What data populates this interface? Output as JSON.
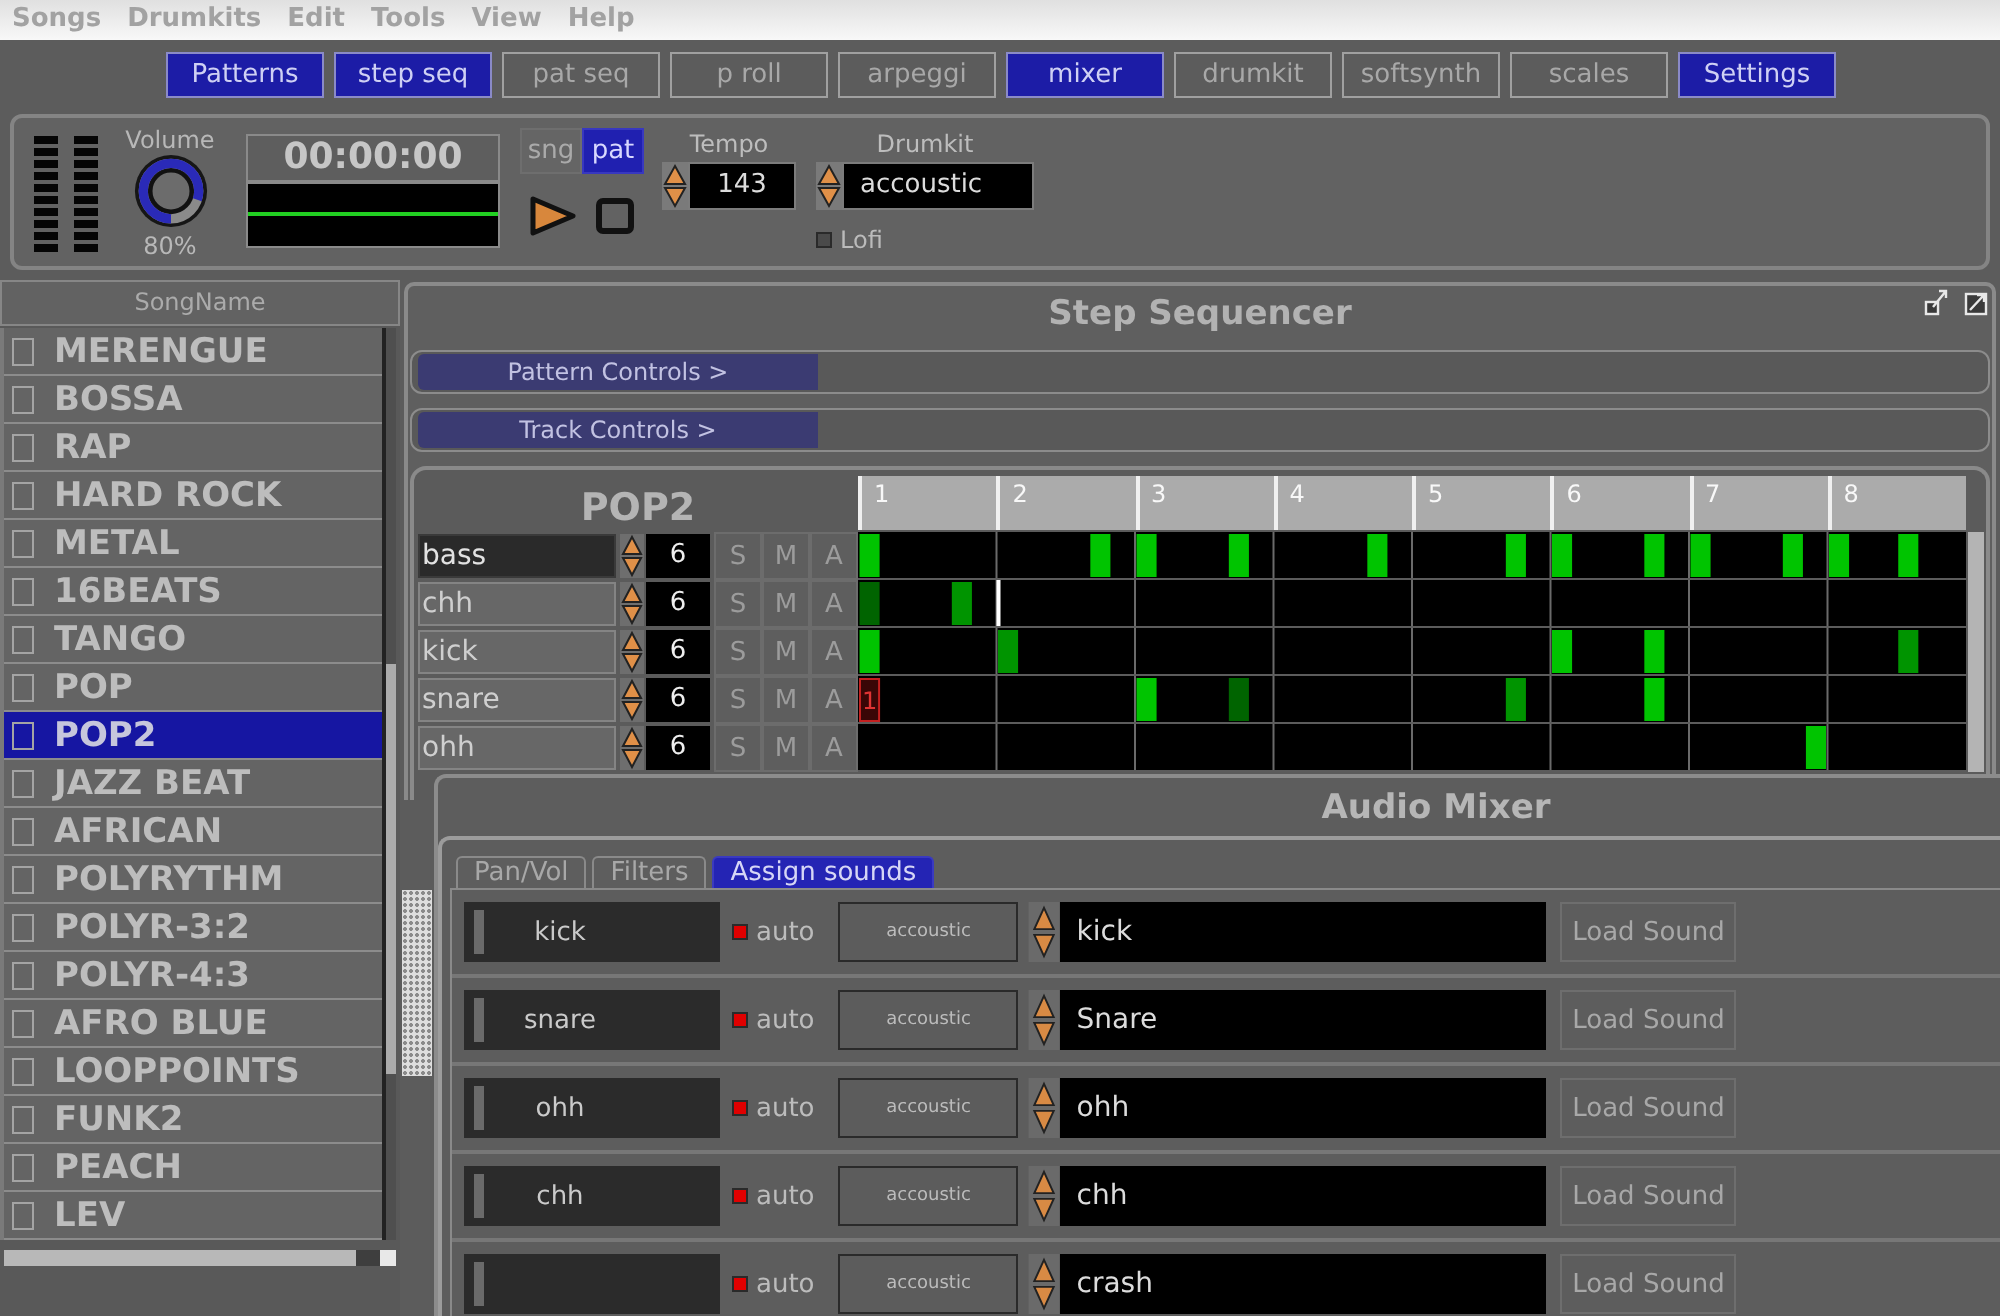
{
  "menu_bar": [
    "Songs",
    "Drumkits",
    "Edit",
    "Tools",
    "View",
    "Help"
  ],
  "view_tabs": [
    {
      "label": "Patterns",
      "selected": true
    },
    {
      "label": "step seq",
      "selected": true
    },
    {
      "label": "pat seq",
      "selected": false
    },
    {
      "label": "p roll",
      "selected": false
    },
    {
      "label": "arpeggi",
      "selected": false
    },
    {
      "label": "mixer",
      "selected": true
    },
    {
      "label": "drumkit",
      "selected": false
    },
    {
      "label": "softsynth",
      "selected": false
    },
    {
      "label": "scales",
      "selected": false
    },
    {
      "label": "Settings",
      "selected": true
    }
  ],
  "transport": {
    "volume": {
      "label": "Volume",
      "level": 0.8,
      "reading": "80%"
    },
    "time": "00:00:00",
    "mode_toggle": [
      {
        "label": "sng",
        "selected": false
      },
      {
        "label": "pat",
        "selected": true
      }
    ],
    "tempo": {
      "label": "Tempo",
      "value": "143"
    },
    "drumkit": {
      "label": "Drumkit",
      "value": "accoustic"
    },
    "lofi": {
      "label": "Lofi",
      "checked": false
    }
  },
  "song_list": {
    "header": "SongName",
    "items": [
      {
        "name": "MERENGUE",
        "checked": false,
        "selected": false
      },
      {
        "name": "BOSSA",
        "checked": false,
        "selected": false
      },
      {
        "name": "RAP",
        "checked": false,
        "selected": false
      },
      {
        "name": "HARD ROCK",
        "checked": false,
        "selected": false
      },
      {
        "name": "METAL",
        "checked": false,
        "selected": false
      },
      {
        "name": "16BEATS",
        "checked": false,
        "selected": false
      },
      {
        "name": "TANGO",
        "checked": false,
        "selected": false
      },
      {
        "name": "POP",
        "checked": false,
        "selected": false
      },
      {
        "name": "POP2",
        "checked": false,
        "selected": true
      },
      {
        "name": "JAZZ BEAT",
        "checked": false,
        "selected": false
      },
      {
        "name": "AFRICAN",
        "checked": false,
        "selected": false
      },
      {
        "name": "POLYRYTHM",
        "checked": false,
        "selected": false
      },
      {
        "name": "POLYR-3:2",
        "checked": false,
        "selected": false
      },
      {
        "name": "POLYR-4:3",
        "checked": false,
        "selected": false
      },
      {
        "name": "AFRO BLUE",
        "checked": false,
        "selected": false
      },
      {
        "name": "LOOPPOINTS",
        "checked": false,
        "selected": false
      },
      {
        "name": "FUNK2",
        "checked": false,
        "selected": false
      },
      {
        "name": "PEACH",
        "checked": false,
        "selected": false
      },
      {
        "name": "LEV",
        "checked": false,
        "selected": false
      }
    ]
  },
  "step_sequencer": {
    "title": "Step Sequencer",
    "sections": [
      "Pattern Controls >",
      "Track Controls >"
    ],
    "pattern_name": "POP2",
    "beats": [
      "1",
      "2",
      "3",
      "4",
      "5",
      "6",
      "7",
      "8"
    ],
    "tracks": [
      {
        "name": "bass",
        "selected": true,
        "value": "6",
        "buttons": [
          "S",
          "M",
          "A"
        ],
        "steps": [
          {
            "kind": "on"
          },
          {
            "kind": "off"
          },
          {
            "kind": "off"
          },
          {
            "kind": "off"
          },
          {
            "kind": "off"
          },
          {
            "kind": "off"
          },
          {
            "kind": "off"
          },
          {
            "kind": "off"
          },
          {
            "kind": "off"
          },
          {
            "kind": "off"
          },
          {
            "kind": "on"
          },
          {
            "kind": "off"
          },
          {
            "kind": "on"
          },
          {
            "kind": "off"
          },
          {
            "kind": "off"
          },
          {
            "kind": "off"
          },
          {
            "kind": "on"
          },
          {
            "kind": "off"
          },
          {
            "kind": "off"
          },
          {
            "kind": "off"
          },
          {
            "kind": "off"
          },
          {
            "kind": "off"
          },
          {
            "kind": "on"
          },
          {
            "kind": "off"
          },
          {
            "kind": "off"
          },
          {
            "kind": "off"
          },
          {
            "kind": "off"
          },
          {
            "kind": "off"
          },
          {
            "kind": "on"
          },
          {
            "kind": "off"
          },
          {
            "kind": "on"
          },
          {
            "kind": "off"
          },
          {
            "kind": "off"
          },
          {
            "kind": "off"
          },
          {
            "kind": "on"
          },
          {
            "kind": "off"
          },
          {
            "kind": "on"
          },
          {
            "kind": "off"
          },
          {
            "kind": "off"
          },
          {
            "kind": "off"
          },
          {
            "kind": "on"
          },
          {
            "kind": "off"
          },
          {
            "kind": "on"
          },
          {
            "kind": "off"
          },
          {
            "kind": "off"
          },
          {
            "kind": "on"
          },
          {
            "kind": "off"
          },
          {
            "kind": "off"
          }
        ]
      },
      {
        "name": "chh",
        "selected": false,
        "value": "6",
        "buttons": [
          "S",
          "M",
          "A"
        ],
        "steps": [
          {
            "kind": "dim"
          },
          {
            "kind": "off"
          },
          {
            "kind": "off"
          },
          {
            "kind": "off"
          },
          {
            "kind": "mid"
          },
          {
            "kind": "off"
          },
          {
            "kind": "mark"
          },
          {
            "kind": "off"
          },
          {
            "kind": "off"
          },
          {
            "kind": "off"
          },
          {
            "kind": "off"
          },
          {
            "kind": "off"
          },
          {
            "kind": "off"
          },
          {
            "kind": "off"
          },
          {
            "kind": "off"
          },
          {
            "kind": "off"
          },
          {
            "kind": "off"
          },
          {
            "kind": "off"
          },
          {
            "kind": "off"
          },
          {
            "kind": "off"
          },
          {
            "kind": "off"
          },
          {
            "kind": "off"
          },
          {
            "kind": "off"
          },
          {
            "kind": "off"
          },
          {
            "kind": "off"
          },
          {
            "kind": "off"
          },
          {
            "kind": "off"
          },
          {
            "kind": "off"
          },
          {
            "kind": "off"
          },
          {
            "kind": "off"
          },
          {
            "kind": "off"
          },
          {
            "kind": "off"
          },
          {
            "kind": "off"
          },
          {
            "kind": "off"
          },
          {
            "kind": "off"
          },
          {
            "kind": "off"
          },
          {
            "kind": "off"
          },
          {
            "kind": "off"
          },
          {
            "kind": "off"
          },
          {
            "kind": "off"
          },
          {
            "kind": "off"
          },
          {
            "kind": "off"
          },
          {
            "kind": "off"
          },
          {
            "kind": "off"
          },
          {
            "kind": "off"
          },
          {
            "kind": "off"
          },
          {
            "kind": "off"
          },
          {
            "kind": "off"
          }
        ]
      },
      {
        "name": "kick",
        "selected": false,
        "value": "6",
        "buttons": [
          "S",
          "M",
          "A"
        ],
        "steps": [
          {
            "kind": "on"
          },
          {
            "kind": "off"
          },
          {
            "kind": "off"
          },
          {
            "kind": "off"
          },
          {
            "kind": "off"
          },
          {
            "kind": "off"
          },
          {
            "kind": "mid"
          },
          {
            "kind": "off"
          },
          {
            "kind": "off"
          },
          {
            "kind": "off"
          },
          {
            "kind": "off"
          },
          {
            "kind": "off"
          },
          {
            "kind": "off"
          },
          {
            "kind": "off"
          },
          {
            "kind": "off"
          },
          {
            "kind": "off"
          },
          {
            "kind": "off"
          },
          {
            "kind": "off"
          },
          {
            "kind": "off"
          },
          {
            "kind": "off"
          },
          {
            "kind": "off"
          },
          {
            "kind": "off"
          },
          {
            "kind": "off"
          },
          {
            "kind": "off"
          },
          {
            "kind": "off"
          },
          {
            "kind": "off"
          },
          {
            "kind": "off"
          },
          {
            "kind": "off"
          },
          {
            "kind": "off"
          },
          {
            "kind": "off"
          },
          {
            "kind": "on"
          },
          {
            "kind": "off"
          },
          {
            "kind": "off"
          },
          {
            "kind": "off"
          },
          {
            "kind": "on"
          },
          {
            "kind": "off"
          },
          {
            "kind": "off"
          },
          {
            "kind": "off"
          },
          {
            "kind": "off"
          },
          {
            "kind": "off"
          },
          {
            "kind": "off"
          },
          {
            "kind": "off"
          },
          {
            "kind": "off"
          },
          {
            "kind": "off"
          },
          {
            "kind": "off"
          },
          {
            "kind": "mid"
          },
          {
            "kind": "off"
          },
          {
            "kind": "off"
          }
        ]
      },
      {
        "name": "snare",
        "selected": false,
        "value": "6",
        "buttons": [
          "S",
          "M",
          "A"
        ],
        "steps": [
          {
            "kind": "cursor",
            "label": "1"
          },
          {
            "kind": "off"
          },
          {
            "kind": "off"
          },
          {
            "kind": "off"
          },
          {
            "kind": "off"
          },
          {
            "kind": "off"
          },
          {
            "kind": "off"
          },
          {
            "kind": "off"
          },
          {
            "kind": "off"
          },
          {
            "kind": "off"
          },
          {
            "kind": "off"
          },
          {
            "kind": "off"
          },
          {
            "kind": "on"
          },
          {
            "kind": "off"
          },
          {
            "kind": "off"
          },
          {
            "kind": "off"
          },
          {
            "kind": "dim"
          },
          {
            "kind": "off"
          },
          {
            "kind": "off"
          },
          {
            "kind": "off"
          },
          {
            "kind": "off"
          },
          {
            "kind": "off"
          },
          {
            "kind": "off"
          },
          {
            "kind": "off"
          },
          {
            "kind": "off"
          },
          {
            "kind": "off"
          },
          {
            "kind": "off"
          },
          {
            "kind": "off"
          },
          {
            "kind": "mid"
          },
          {
            "kind": "off"
          },
          {
            "kind": "off"
          },
          {
            "kind": "off"
          },
          {
            "kind": "off"
          },
          {
            "kind": "off"
          },
          {
            "kind": "on"
          },
          {
            "kind": "off"
          },
          {
            "kind": "off"
          },
          {
            "kind": "off"
          },
          {
            "kind": "off"
          },
          {
            "kind": "off"
          },
          {
            "kind": "off"
          },
          {
            "kind": "off"
          },
          {
            "kind": "off"
          },
          {
            "kind": "off"
          },
          {
            "kind": "off"
          },
          {
            "kind": "off"
          },
          {
            "kind": "off"
          },
          {
            "kind": "off"
          }
        ]
      },
      {
        "name": "ohh",
        "selected": false,
        "value": "6",
        "buttons": [
          "S",
          "M",
          "A"
        ],
        "steps": [
          {
            "kind": "off"
          },
          {
            "kind": "off"
          },
          {
            "kind": "off"
          },
          {
            "kind": "off"
          },
          {
            "kind": "off"
          },
          {
            "kind": "off"
          },
          {
            "kind": "off"
          },
          {
            "kind": "off"
          },
          {
            "kind": "off"
          },
          {
            "kind": "off"
          },
          {
            "kind": "off"
          },
          {
            "kind": "off"
          },
          {
            "kind": "off"
          },
          {
            "kind": "off"
          },
          {
            "kind": "off"
          },
          {
            "kind": "off"
          },
          {
            "kind": "off"
          },
          {
            "kind": "off"
          },
          {
            "kind": "off"
          },
          {
            "kind": "off"
          },
          {
            "kind": "off"
          },
          {
            "kind": "off"
          },
          {
            "kind": "off"
          },
          {
            "kind": "off"
          },
          {
            "kind": "off"
          },
          {
            "kind": "off"
          },
          {
            "kind": "off"
          },
          {
            "kind": "off"
          },
          {
            "kind": "off"
          },
          {
            "kind": "off"
          },
          {
            "kind": "off"
          },
          {
            "kind": "off"
          },
          {
            "kind": "off"
          },
          {
            "kind": "off"
          },
          {
            "kind": "off"
          },
          {
            "kind": "off"
          },
          {
            "kind": "off"
          },
          {
            "kind": "off"
          },
          {
            "kind": "off"
          },
          {
            "kind": "off"
          },
          {
            "kind": "off"
          },
          {
            "kind": "on"
          },
          {
            "kind": "off"
          },
          {
            "kind": "off"
          },
          {
            "kind": "off"
          },
          {
            "kind": "off"
          },
          {
            "kind": "off"
          },
          {
            "kind": "off"
          }
        ]
      }
    ]
  },
  "audio_mixer": {
    "title": "Audio Mixer",
    "tabs": [
      {
        "label": "Pan/Vol",
        "selected": false
      },
      {
        "label": "Filters",
        "selected": false
      },
      {
        "label": "Assign sounds",
        "selected": true
      }
    ],
    "rows": [
      {
        "name": "kick",
        "auto": {
          "label": "auto",
          "on": true
        },
        "kit": "accoustic",
        "sound": "kick",
        "button": "Load Sound"
      },
      {
        "name": "snare",
        "auto": {
          "label": "auto",
          "on": true
        },
        "kit": "accoustic",
        "sound": "Snare",
        "button": "Load Sound"
      },
      {
        "name": "ohh",
        "auto": {
          "label": "auto",
          "on": true
        },
        "kit": "accoustic",
        "sound": "ohh",
        "button": "Load Sound"
      },
      {
        "name": "chh",
        "auto": {
          "label": "auto",
          "on": true
        },
        "kit": "accoustic",
        "sound": "chh",
        "button": "Load Sound"
      },
      {
        "auto": {
          "label": "auto",
          "on": true
        },
        "kit": "accoustic",
        "sound": "crash",
        "button": "Load Sound"
      }
    ]
  }
}
